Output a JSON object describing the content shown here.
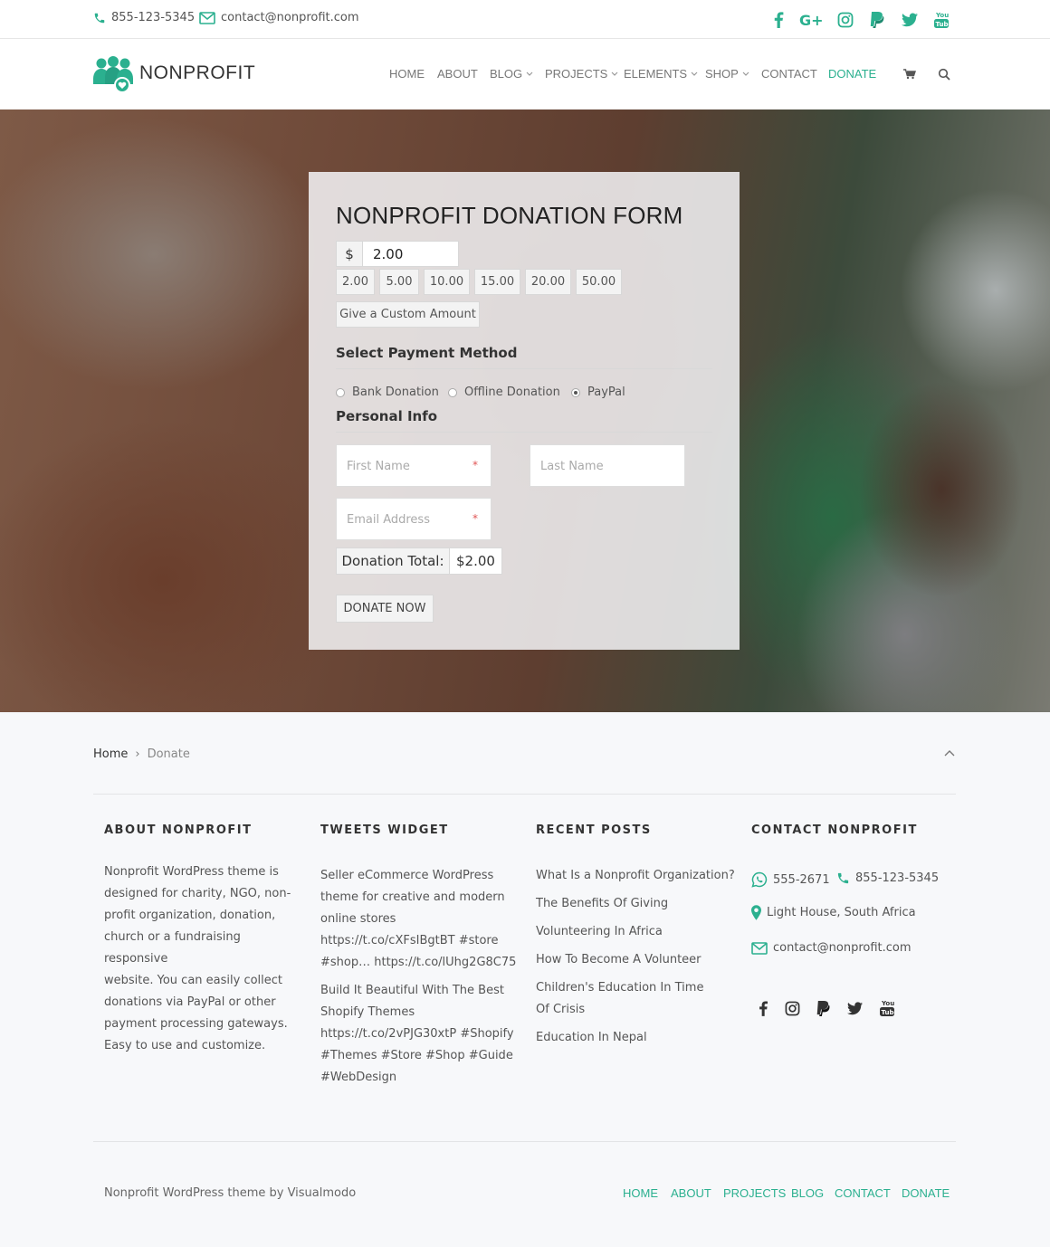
{
  "colors": {
    "accent": "#2bb08f",
    "text": "#444444",
    "background": "#f7f8fa"
  },
  "topbar": {
    "phone": "855-123-5345",
    "email": "contact@nonprofit.com",
    "social_icons": [
      "facebook-icon",
      "google-plus-icon",
      "instagram-icon",
      "paypal-icon",
      "twitter-icon",
      "youtube-icon"
    ]
  },
  "header": {
    "logo_text": "NONPROFIT",
    "nav": [
      "HOME",
      "ABOUT",
      "BLOG",
      "PROJECTS",
      "ELEMENTS",
      "SHOP",
      "CONTACT",
      "DONATE"
    ],
    "active_nav": "DONATE"
  },
  "form": {
    "title": "NONPROFIT DONATION FORM",
    "currency": "$",
    "amount": "2.00",
    "presets": [
      "2.00",
      "5.00",
      "10.00",
      "15.00",
      "20.00",
      "50.00"
    ],
    "custom_amount_label": "Give a Custom Amount",
    "payment_heading": "Select Payment Method",
    "payment_methods": [
      "Bank Donation",
      "Offline Donation",
      "PayPal"
    ],
    "selected_payment": "PayPal",
    "personal_heading": "Personal Info",
    "first_name_placeholder": "First Name",
    "last_name_placeholder": "Last Name",
    "email_placeholder": "Email Address",
    "required_mark": "*",
    "total_label": "Donation Total:",
    "total_value": "$2.00",
    "submit_label": "DONATE NOW"
  },
  "breadcrumb": {
    "home": "Home",
    "separator": "›",
    "current": "Donate"
  },
  "footer": {
    "about": {
      "title": "ABOUT NONPROFIT",
      "lines": [
        "Nonprofit WordPress theme is",
        "designed for charity, NGO, non-",
        "profit organization, donation,",
        "church or a fundraising responsive",
        "website. You can easily collect",
        "donations via PayPal or other",
        "payment processing gateways.",
        "Easy to use and customize."
      ]
    },
    "tweets": {
      "title": "TWEETS WIDGET",
      "tweet1": [
        "Seller eCommerce WordPress",
        "theme for creative and modern",
        "online stores",
        "https://t.co/cXFsIBgtBT #store",
        "#shop… https://t.co/lUhg2G8C75"
      ],
      "tweet2": [
        "Build It Beautiful With The Best",
        "Shopify Themes",
        "https://t.co/2vPJG30xtP #Shopify",
        "#Themes #Store #Shop #Guide",
        "#WebDesign"
      ]
    },
    "recent": {
      "title": "RECENT POSTS",
      "posts": [
        "What Is a Nonprofit Organization?",
        "The Benefits Of Giving",
        "Volunteering In Africa",
        "How To Become A Volunteer",
        "Children's Education In Time Of Crisis",
        "Education In Nepal"
      ]
    },
    "contact": {
      "title": "CONTACT NONPROFIT",
      "whatsapp": "555-2671",
      "phone": "855-123-5345",
      "address": "Light House, South Africa",
      "email": "contact@nonprofit.com",
      "social_icons": [
        "facebook-icon",
        "instagram-icon",
        "paypal-icon",
        "twitter-icon",
        "youtube-icon"
      ]
    },
    "credit": "Nonprofit WordPress theme by Visualmodo",
    "nav": [
      "HOME",
      "ABOUT",
      "PROJECTS",
      "BLOG",
      "CONTACT",
      "DONATE"
    ]
  }
}
